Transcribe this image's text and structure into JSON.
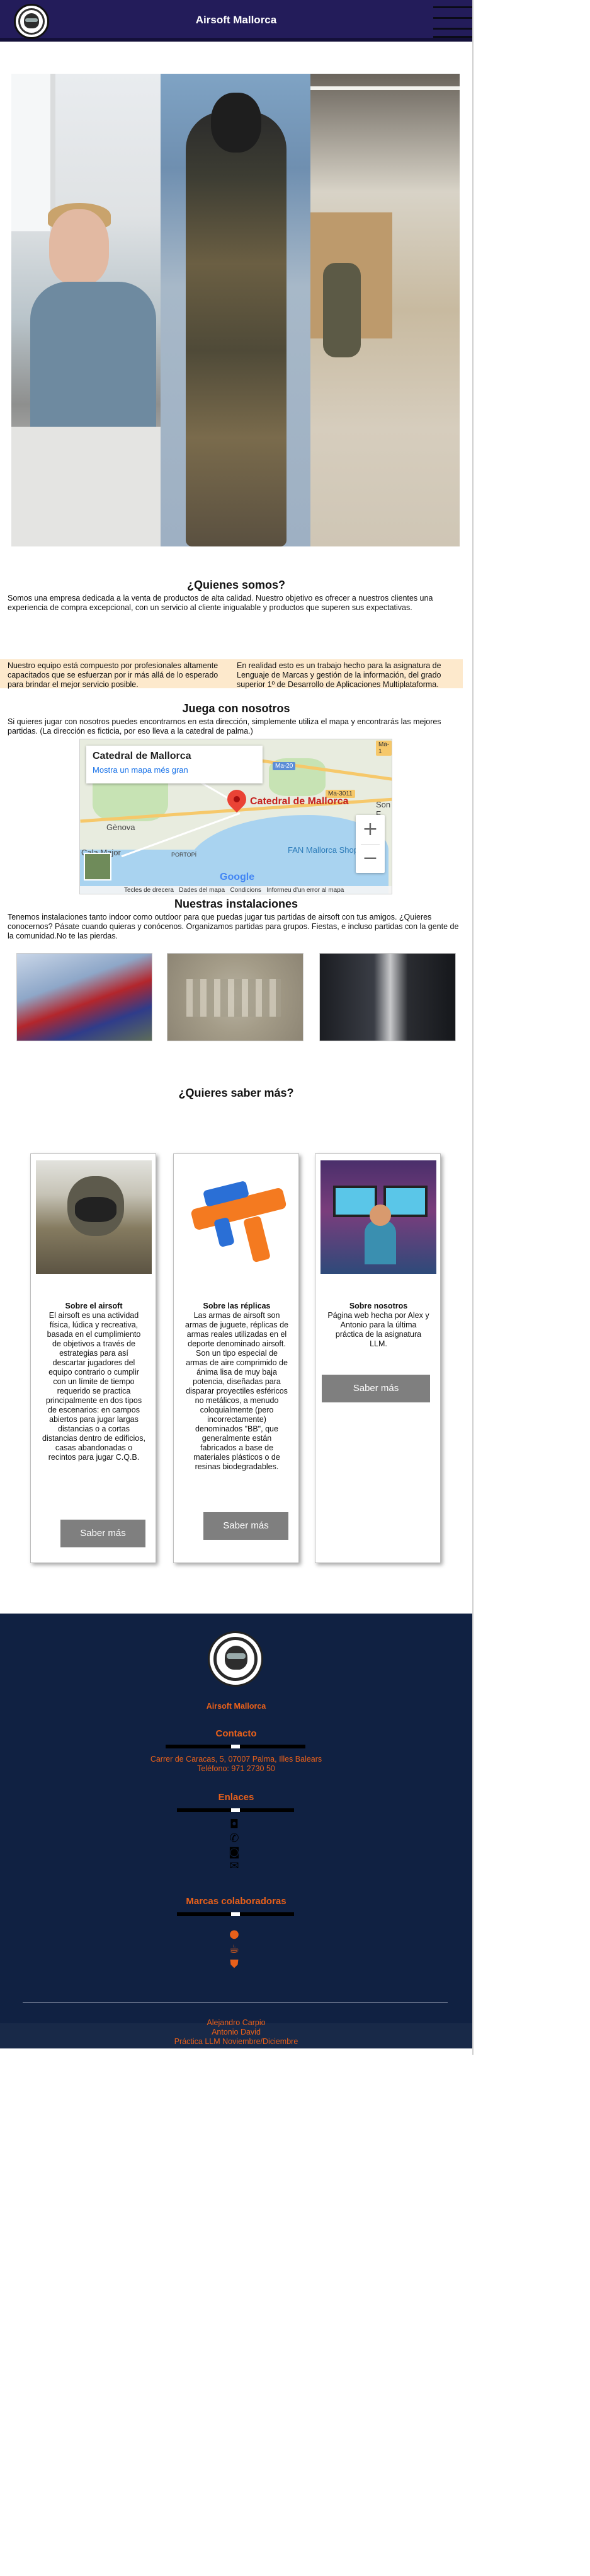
{
  "header": {
    "title": "Airsoft Mallorca",
    "menu_icon": "hamburger-menu-icon"
  },
  "about": {
    "heading": "¿Quienes somos?",
    "intro": "Somos una empresa dedicada a la venta de productos de alta calidad. Nuestro objetivo es ofrecer a nuestros clientes una experiencia de compra excepcional, con un servicio al cliente inigualable y productos que superen sus expectativas.",
    "team_left": "Nuestro equipo está compuesto por profesionales altamente capacitados que se esfuerzan por ir más allá de lo esperado para brindar el mejor servicio posible.",
    "team_right": "En realidad esto es un trabajo hecho para la asignatura de Lenguaje de Marcas y gestión de la información, del grado superior 1º de Desarrollo de Aplicaciones Multiplataforma."
  },
  "visit": {
    "heading": "Juega con nosotros",
    "text": "Si quieres jugar con nosotros puedes encontrarnos en esta dirección, simplemente utiliza el mapa y encontrarás las mejores partidas. (La dirección es ficticia, por eso lleva a la catedral de palma.)"
  },
  "map": {
    "place_name": "Catedral de Mallorca",
    "larger_map_link": "Mostra un mapa més gran",
    "pin_label": "Catedral de Mallorca",
    "labels": [
      "Gènova",
      "Cala Major",
      "FAN Mallorca Shoppin",
      "PORTOPÍ",
      "Son F",
      "Ma-20",
      "Ma-3011",
      "Ma-1"
    ],
    "zoom_in": "+",
    "zoom_out": "−",
    "footer": [
      "Tecles de drecera",
      "Dades del mapa",
      "Condicions",
      "Informeu d'un error al mapa"
    ],
    "google_logo": "Google"
  },
  "facilities": {
    "heading": "Nuestras instalaciones",
    "text": "Tenemos instalaciones tanto indoor como outdoor para que puedas jugar tus partidas de airsoft con tus amigos. ¿Quieres conocernos? Pásate cuando quieras y conócenos. Organizamos partidas para grupos. Fiestas, e incluso partidas con la gente de la comunidad.No te las pierdas."
  },
  "more": {
    "heading": "¿Quieres saber más?",
    "cards": [
      {
        "title": "Sobre el airsoft",
        "text": "El airsoft es una actividad física, lúdica y recreativa, basada en el cumplimiento de objetivos a través de estrategias para así descartar jugadores del equipo contrario o cumplir con un límite de tiempo requerido se practica principalmente en dos tipos de escenarios: en campos abiertos para jugar largas distancias o a cortas distancias dentro de edificios, casas abandonadas o recintos para jugar C.Q.B.",
        "button": "Saber más"
      },
      {
        "title": "Sobre las réplicas",
        "text": "Las armas de airsoft son armas de juguete, réplicas de armas reales utilizadas en el deporte denominado airsoft. Son un tipo especial de armas de aire comprimido de ánima lisa de muy baja potencia, diseñadas para disparar proyectiles esféricos no metálicos, a menudo coloquialmente (pero incorrectamente) denominados \"BB\", que generalmente están fabricados a base de materiales plásticos o de resinas biodegradables.",
        "button": "Saber más"
      },
      {
        "title": "Sobre nosotros",
        "text": "Página web hecha por Alex y Antonio para la última práctica de la asignatura LLM.",
        "button": "Saber más"
      }
    ]
  },
  "footer": {
    "brand": "Airsoft Mallorca",
    "contact_heading": "Contacto",
    "address": "Carrer de Caracas, 5, 07007 Palma, Illes Balears",
    "phone": "Teléfono: 971 2730 50",
    "links_heading": "Enlaces",
    "link_icons": [
      "instagram-icon",
      "twitter-icon",
      "github-icon",
      "mail-icon"
    ],
    "brands_heading": "Marcas colaboradoras",
    "brand_icons": [
      "apple-icon",
      "java-icon",
      "html5-icon"
    ],
    "credits": [
      "Alejandro Carpio",
      "Antonio David",
      "Práctica LLM Noviembre/Diciembre"
    ]
  },
  "colors": {
    "header_bg": "#231c5a",
    "footer_bg": "#102142",
    "accent": "#e8601a",
    "team_band": "#fde9cc",
    "button": "#7f7f7f"
  }
}
